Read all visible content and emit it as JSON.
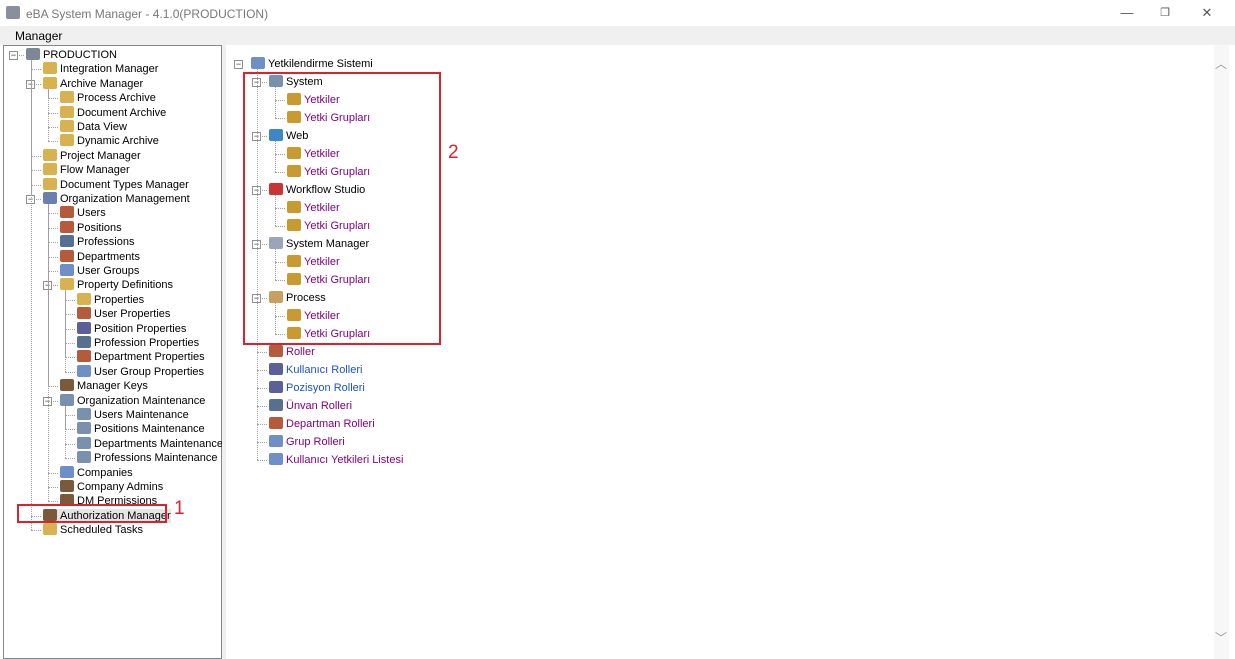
{
  "window": {
    "title": "eBA System Manager - 4.1.0(PRODUCTION)",
    "minimize": "—",
    "restore": "❐",
    "close": "✕"
  },
  "menu": {
    "manager": "Manager"
  },
  "left_tree": [
    {
      "label": "PRODUCTION",
      "depth": 0,
      "icon": "server",
      "expanded": true
    },
    {
      "label": "Integration Manager",
      "depth": 1,
      "icon": "folder"
    },
    {
      "label": "Archive Manager",
      "depth": 1,
      "icon": "folder",
      "expanded": true
    },
    {
      "label": "Process Archive",
      "depth": 2,
      "icon": "folder"
    },
    {
      "label": "Document Archive",
      "depth": 2,
      "icon": "folder"
    },
    {
      "label": "Data View",
      "depth": 2,
      "icon": "folder"
    },
    {
      "label": "Dynamic Archive",
      "depth": 2,
      "icon": "folder"
    },
    {
      "label": "Project Manager",
      "depth": 1,
      "icon": "folder"
    },
    {
      "label": "Flow Manager",
      "depth": 1,
      "icon": "folder"
    },
    {
      "label": "Document Types Manager",
      "depth": 1,
      "icon": "folder"
    },
    {
      "label": "Organization Management",
      "depth": 1,
      "icon": "org",
      "expanded": true
    },
    {
      "label": "Users",
      "depth": 2,
      "icon": "users"
    },
    {
      "label": "Positions",
      "depth": 2,
      "icon": "users"
    },
    {
      "label": "Professions",
      "depth": 2,
      "icon": "card"
    },
    {
      "label": "Departments",
      "depth": 2,
      "icon": "users"
    },
    {
      "label": "User Groups",
      "depth": 2,
      "icon": "group"
    },
    {
      "label": "Property Definitions",
      "depth": 2,
      "icon": "folder",
      "expanded": true
    },
    {
      "label": "Properties",
      "depth": 3,
      "icon": "folder"
    },
    {
      "label": "User Properties",
      "depth": 3,
      "icon": "users"
    },
    {
      "label": "Position Properties",
      "depth": 3,
      "icon": "person"
    },
    {
      "label": "Profession Properties",
      "depth": 3,
      "icon": "card"
    },
    {
      "label": "Department Properties",
      "depth": 3,
      "icon": "users"
    },
    {
      "label": "User Group Properties",
      "depth": 3,
      "icon": "group"
    },
    {
      "label": "Manager Keys",
      "depth": 2,
      "icon": "key-person"
    },
    {
      "label": "Organization Maintenance",
      "depth": 2,
      "icon": "gear",
      "expanded": true
    },
    {
      "label": "Users Maintenance",
      "depth": 3,
      "icon": "gear"
    },
    {
      "label": "Positions Maintenance",
      "depth": 3,
      "icon": "gear"
    },
    {
      "label": "Departments Maintenance",
      "depth": 3,
      "icon": "gear"
    },
    {
      "label": "Professions Maintenance",
      "depth": 3,
      "icon": "gear"
    },
    {
      "label": "Companies",
      "depth": 2,
      "icon": "group"
    },
    {
      "label": "Company Admins",
      "depth": 2,
      "icon": "key-person"
    },
    {
      "label": "DM Permissions",
      "depth": 2,
      "icon": "key-person"
    },
    {
      "label": "Authorization Manager",
      "depth": 1,
      "icon": "key-person",
      "selected": true
    },
    {
      "label": "Scheduled Tasks",
      "depth": 1,
      "icon": "folder"
    }
  ],
  "right_tree": [
    {
      "label": "Yetkilendirme Sistemi",
      "depth": 0,
      "icon": "group",
      "expanded": true,
      "color": "black"
    },
    {
      "label": "System",
      "depth": 1,
      "icon": "gear",
      "expanded": true,
      "color": "black"
    },
    {
      "label": "Yetkiler",
      "depth": 2,
      "icon": "key",
      "color": "purple"
    },
    {
      "label": "Yetki Grupları",
      "depth": 2,
      "icon": "keys",
      "color": "purple"
    },
    {
      "label": "Web",
      "depth": 1,
      "icon": "web",
      "expanded": true,
      "color": "black"
    },
    {
      "label": "Yetkiler",
      "depth": 2,
      "icon": "key",
      "color": "purple"
    },
    {
      "label": "Yetki Grupları",
      "depth": 2,
      "icon": "keys",
      "color": "purple"
    },
    {
      "label": "Workflow Studio",
      "depth": 1,
      "icon": "studio",
      "expanded": true,
      "color": "black"
    },
    {
      "label": "Yetkiler",
      "depth": 2,
      "icon": "key",
      "color": "purple"
    },
    {
      "label": "Yetki Grupları",
      "depth": 2,
      "icon": "keys",
      "color": "purple"
    },
    {
      "label": "System Manager",
      "depth": 1,
      "icon": "manager",
      "expanded": true,
      "color": "black"
    },
    {
      "label": "Yetkiler",
      "depth": 2,
      "icon": "key",
      "color": "purple"
    },
    {
      "label": "Yetki Grupları",
      "depth": 2,
      "icon": "keys",
      "color": "purple"
    },
    {
      "label": "Process",
      "depth": 1,
      "icon": "process",
      "expanded": true,
      "color": "black"
    },
    {
      "label": "Yetkiler",
      "depth": 2,
      "icon": "key",
      "color": "purple"
    },
    {
      "label": "Yetki Grupları",
      "depth": 2,
      "icon": "keys",
      "color": "purple"
    },
    {
      "label": "Roller",
      "depth": 1,
      "icon": "users",
      "color": "purple"
    },
    {
      "label": "Kullanıcı Rolleri",
      "depth": 1,
      "icon": "person",
      "color": "blue"
    },
    {
      "label": "Pozisyon Rolleri",
      "depth": 1,
      "icon": "person",
      "color": "blue"
    },
    {
      "label": "Ünvan Rolleri",
      "depth": 1,
      "icon": "card",
      "color": "purple"
    },
    {
      "label": "Departman Rolleri",
      "depth": 1,
      "icon": "users",
      "color": "purple"
    },
    {
      "label": "Grup Rolleri",
      "depth": 1,
      "icon": "group",
      "color": "purple"
    },
    {
      "label": "Kullanıcı Yetkileri Listesi",
      "depth": 1,
      "icon": "group",
      "color": "purple"
    }
  ],
  "annotations": {
    "callout1": "1",
    "callout2": "2"
  },
  "scroll": {
    "up": "︿",
    "down": "﹀"
  },
  "colors": {
    "highlight": "#d9232e",
    "link_purple": "#800080",
    "link_blue": "#1a52c8"
  }
}
